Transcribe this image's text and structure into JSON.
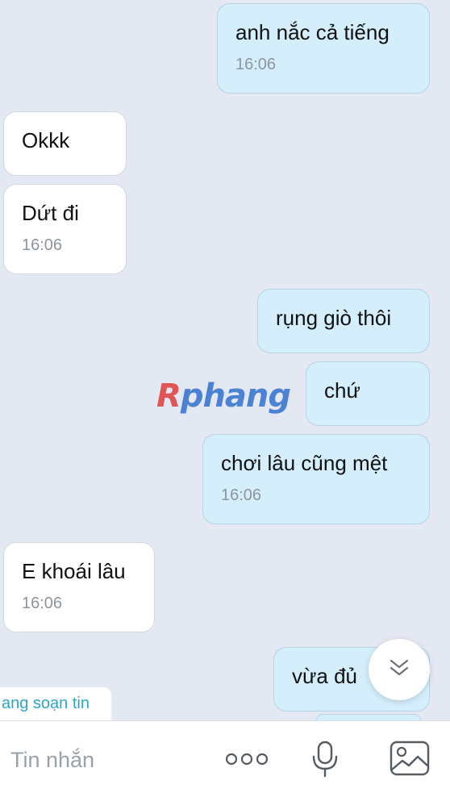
{
  "messages": [
    {
      "text": "anh nắc cả tiếng",
      "time": "16:06"
    },
    {
      "text": "Okkk"
    },
    {
      "text": "Dứt đi",
      "time": "16:06"
    },
    {
      "text": "rụng giò thôi"
    },
    {
      "text": "chứ"
    },
    {
      "text": "chơi lâu cũng mệt",
      "time": "16:06"
    },
    {
      "text": "E khoái lâu",
      "time": "16:06"
    },
    {
      "text": "vừa đủ"
    }
  ],
  "typing_indicator": "ang soạn tin",
  "watermark": {
    "r": "R",
    "rest": "phang"
  },
  "input": {
    "placeholder": "Tin nhắn"
  },
  "icons": {
    "scroll": "chevron-double-down-icon",
    "more": "more-dots-icon",
    "mic": "microphone-icon",
    "image": "image-icon"
  },
  "colors": {
    "background": "#e4e8f2",
    "bubble_out": "#d4eefc",
    "bubble_in": "#ffffff",
    "typing_text": "#2ea7c6"
  }
}
